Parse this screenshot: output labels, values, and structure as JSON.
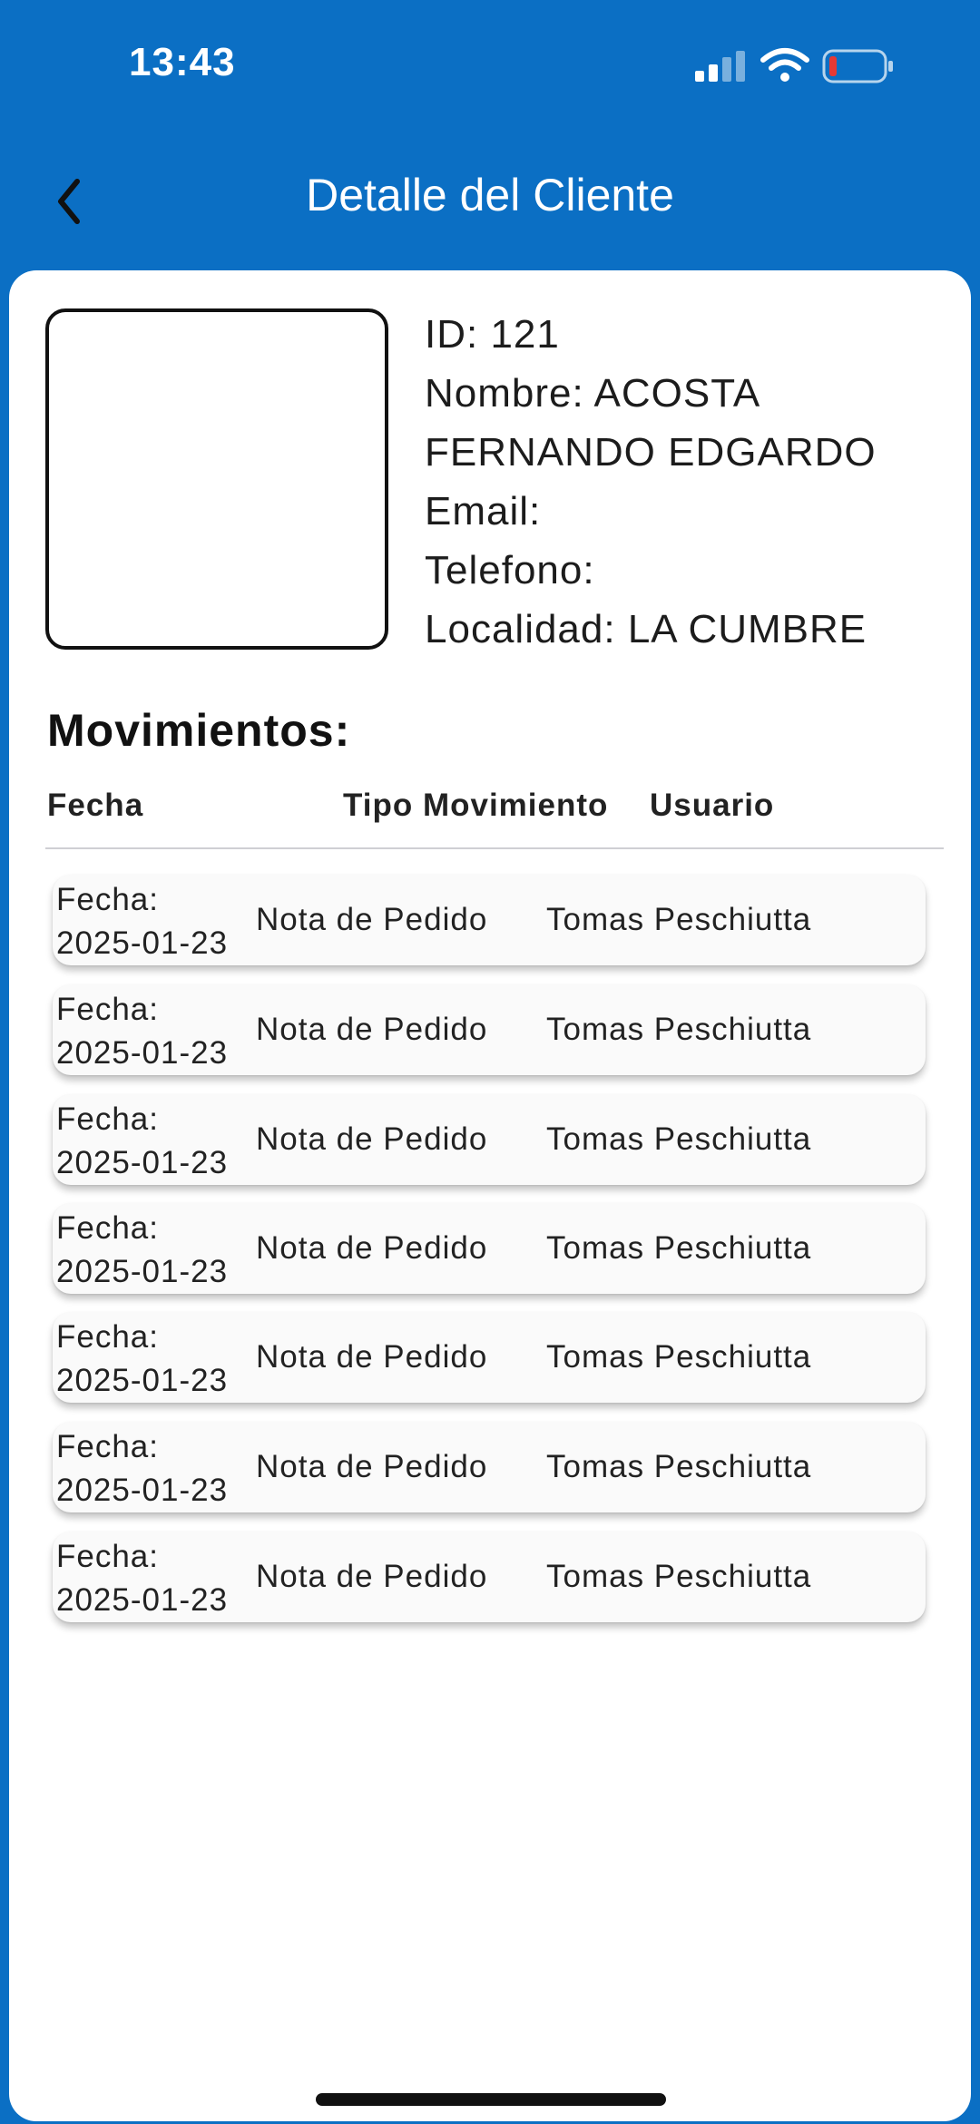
{
  "status_bar": {
    "time": "13:43",
    "icons": [
      "signal-icon",
      "wifi-icon",
      "battery-icon"
    ],
    "battery_color": "#e53935"
  },
  "nav": {
    "title": "Detalle del Cliente",
    "back_icon": "chevron-left-icon"
  },
  "colors": {
    "primary": "#0b6fc4",
    "card": "#ffffff",
    "row_bg": "#fafafa"
  },
  "client": {
    "id_line": "ID: 121",
    "name_line_1": "Nombre: ACOSTA",
    "name_line_2": "FERNANDO EDGARDO",
    "email_line": "Email:",
    "phone_line": "Telefono:",
    "locality_line": "Localidad: LA CUMBRE"
  },
  "movements": {
    "title": "Movimientos:",
    "columns": [
      "Fecha",
      "Tipo Movimiento",
      "Usuario"
    ],
    "rows": [
      {
        "fecha_label": "Fecha:",
        "fecha": "2025-01-23",
        "tipo": "Nota de Pedido",
        "usuario": "Tomas Peschiutta"
      },
      {
        "fecha_label": "Fecha:",
        "fecha": "2025-01-23",
        "tipo": "Nota de Pedido",
        "usuario": "Tomas Peschiutta"
      },
      {
        "fecha_label": "Fecha:",
        "fecha": "2025-01-23",
        "tipo": "Nota de Pedido",
        "usuario": "Tomas Peschiutta"
      },
      {
        "fecha_label": "Fecha:",
        "fecha": "2025-01-23",
        "tipo": "Nota de Pedido",
        "usuario": "Tomas Peschiutta"
      },
      {
        "fecha_label": "Fecha:",
        "fecha": "2025-01-23",
        "tipo": "Nota de Pedido",
        "usuario": "Tomas Peschiutta"
      },
      {
        "fecha_label": "Fecha:",
        "fecha": "2025-01-23",
        "tipo": "Nota de Pedido",
        "usuario": "Tomas Peschiutta"
      },
      {
        "fecha_label": "Fecha:",
        "fecha": "2025-01-23",
        "tipo": "Nota de Pedido",
        "usuario": "Tomas Peschiutta"
      }
    ]
  }
}
